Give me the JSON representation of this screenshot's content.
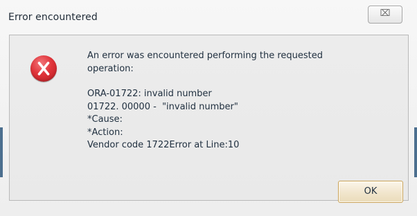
{
  "window": {
    "title": "Error encountered",
    "close_glyph": "⌧"
  },
  "dialog": {
    "icon": "error-x-icon",
    "message_lines": [
      "An error was encountered performing the requested",
      "operation:"
    ],
    "detail_lines": [
      "ORA-01722: invalid number",
      "01722. 00000 -  \"invalid number\"",
      "*Cause:",
      "*Action:",
      "Vendor code 1722Error at Line:10"
    ],
    "ok_label": "OK"
  },
  "colors": {
    "error_red": "#e0343a",
    "ok_border": "#c9a35a",
    "text": "#1f2f3f"
  }
}
